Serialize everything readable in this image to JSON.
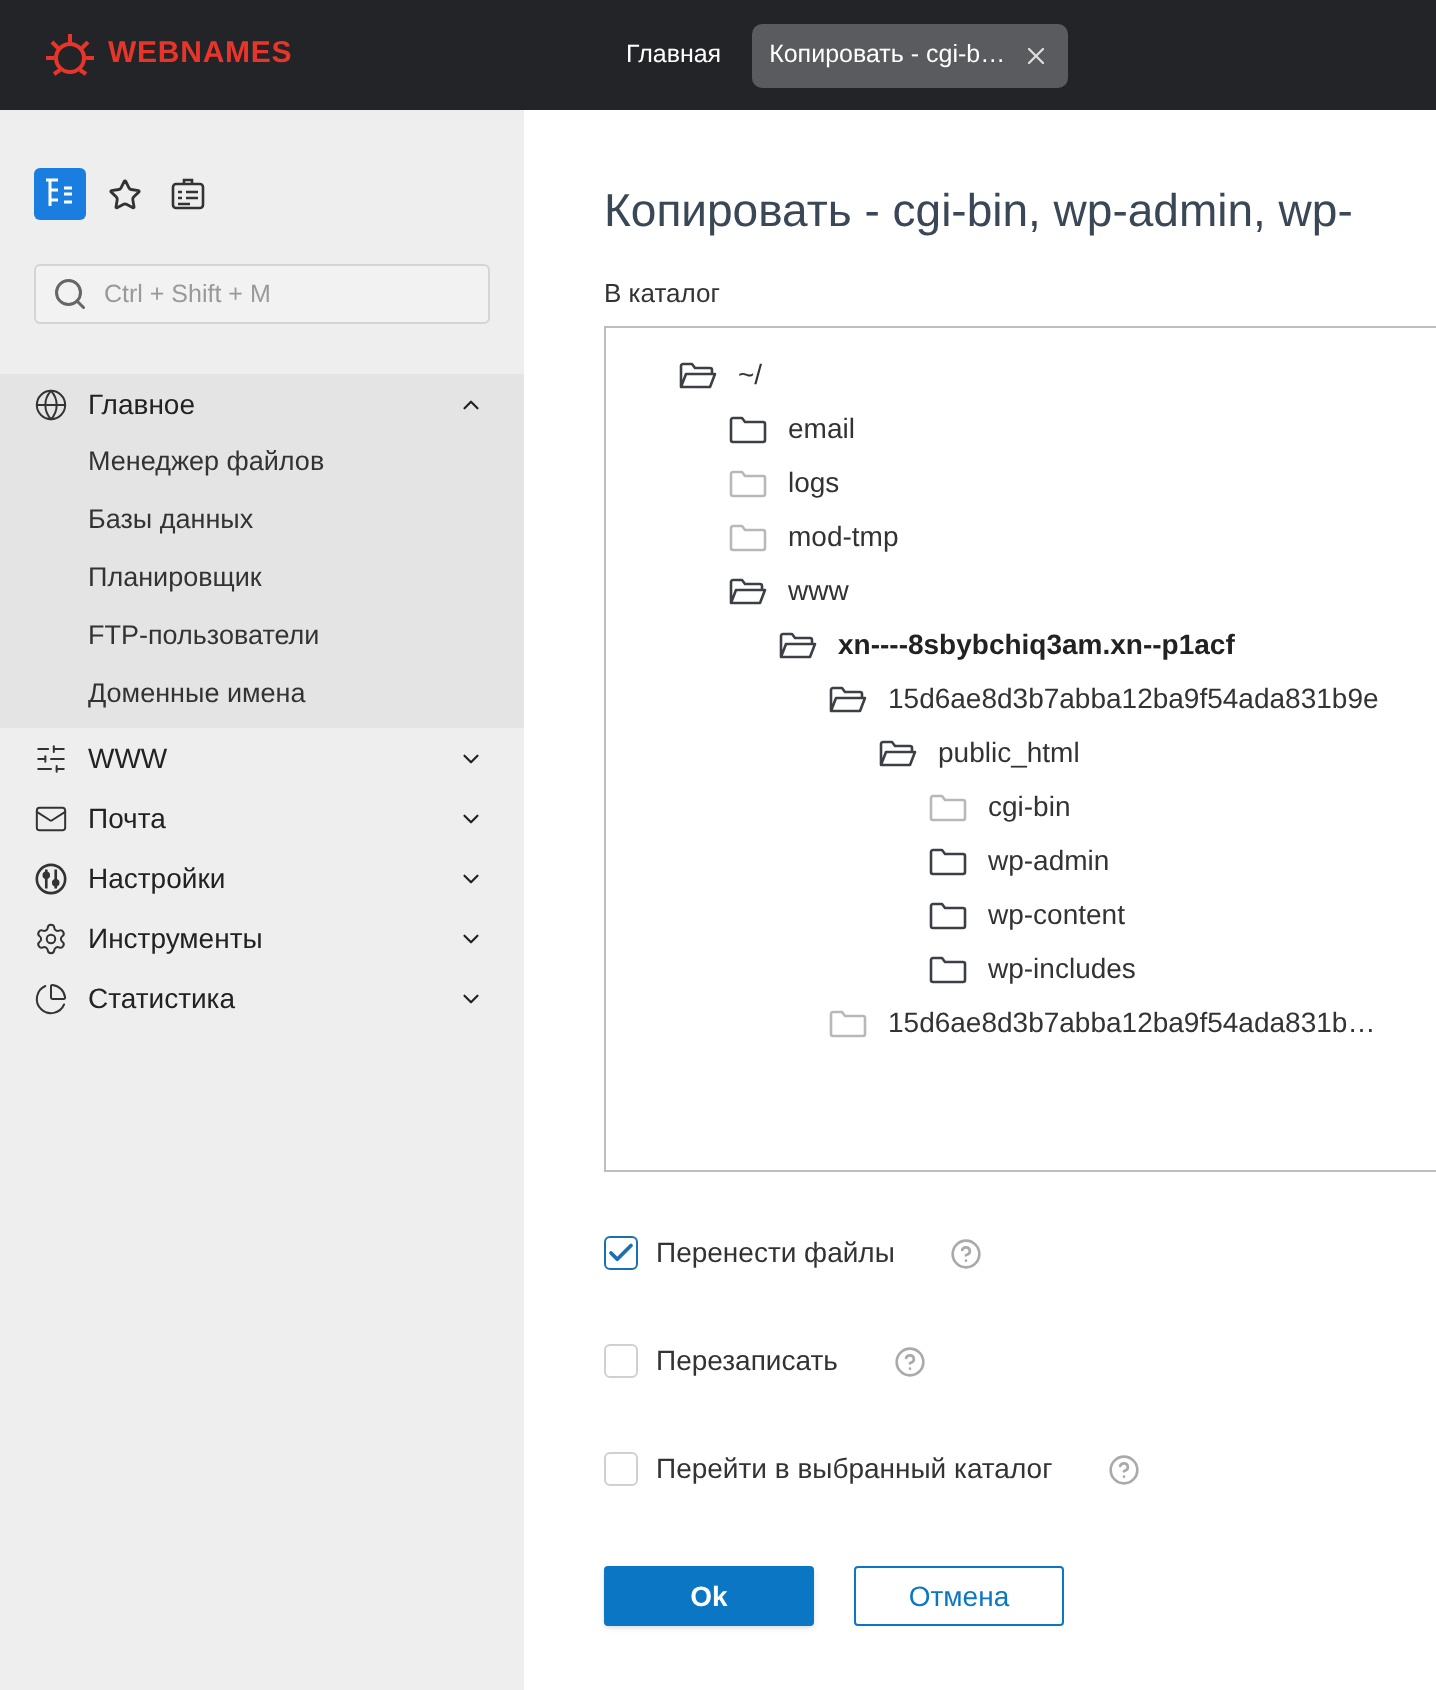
{
  "header": {
    "logo": "WEBNAMES",
    "tabs": [
      {
        "label": "Главная",
        "selected": false,
        "closable": false
      },
      {
        "label": "Копировать - cgi-b…",
        "selected": true,
        "closable": true
      }
    ]
  },
  "sidebar": {
    "search": {
      "placeholder": "Ctrl + Shift + M"
    },
    "view_buttons": [
      {
        "selected": true
      },
      {
        "selected": false
      },
      {
        "selected": false
      }
    ],
    "menu": [
      {
        "label": "Главное",
        "expanded": true,
        "children": [
          "Менеджер файлов",
          "Базы данных",
          "Планировщик",
          "FTP-пользователи",
          "Доменные имена"
        ]
      },
      {
        "label": "WWW",
        "expanded": false
      },
      {
        "label": "Почта",
        "expanded": false
      },
      {
        "label": "Настройки",
        "expanded": false
      },
      {
        "label": "Инструменты",
        "expanded": false
      },
      {
        "label": "Статистика",
        "expanded": false
      }
    ]
  },
  "dialog": {
    "title": "Копировать - cgi-bin, wp-admin, wp-",
    "tree_label": "В каталог",
    "tree": [
      {
        "name": "~/",
        "open": true,
        "dimmed": false,
        "selected": false,
        "children": [
          {
            "name": "email",
            "open": false,
            "dimmed": false,
            "selected": false
          },
          {
            "name": "logs",
            "open": false,
            "dimmed": true,
            "selected": false
          },
          {
            "name": "mod-tmp",
            "open": false,
            "dimmed": true,
            "selected": false
          },
          {
            "name": "www",
            "open": true,
            "dimmed": false,
            "selected": false,
            "children": [
              {
                "name": "xn----8sbybchiq3am.xn--p1acf",
                "open": true,
                "dimmed": false,
                "selected": true,
                "children": [
                  {
                    "name": "15d6ae8d3b7abba12ba9f54ada831b9e",
                    "open": true,
                    "dimmed": false,
                    "selected": false,
                    "children": [
                      {
                        "name": "public_html",
                        "open": true,
                        "dimmed": false,
                        "selected": false,
                        "children": [
                          {
                            "name": "cgi-bin",
                            "open": false,
                            "dimmed": true,
                            "selected": false
                          },
                          {
                            "name": "wp-admin",
                            "open": false,
                            "dimmed": false,
                            "selected": false
                          },
                          {
                            "name": "wp-content",
                            "open": false,
                            "dimmed": false,
                            "selected": false
                          },
                          {
                            "name": "wp-includes",
                            "open": false,
                            "dimmed": false,
                            "selected": false
                          }
                        ]
                      }
                    ]
                  },
                  {
                    "name": "15d6ae8d3b7abba12ba9f54ada831b…",
                    "open": false,
                    "dimmed": true,
                    "selected": false
                  }
                ]
              }
            ]
          }
        ]
      }
    ],
    "options": [
      {
        "label": "Перенести файлы",
        "checked": true
      },
      {
        "label": "Перезаписать",
        "checked": false
      },
      {
        "label": "Перейти в выбранный каталог",
        "checked": false
      }
    ],
    "buttons": [
      {
        "label": "Ok",
        "kind": "primary"
      },
      {
        "label": "Отмена",
        "kind": "secondary"
      }
    ]
  }
}
